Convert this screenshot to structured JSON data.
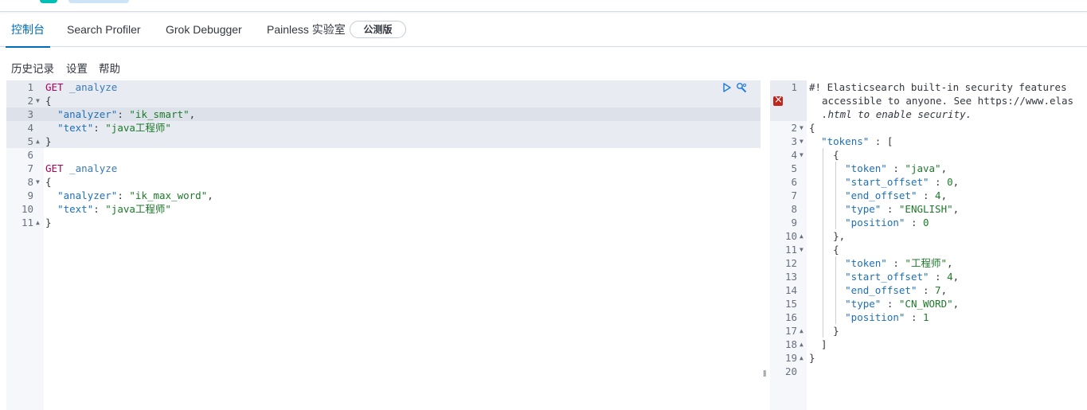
{
  "tabs": [
    {
      "label": "控制台",
      "active": true
    },
    {
      "label": "Search Profiler",
      "active": false
    },
    {
      "label": "Grok Debugger",
      "active": false
    },
    {
      "label": "Painless 实验室",
      "active": false
    }
  ],
  "beta_badge": "公测版",
  "toolbar": {
    "history": "历史记录",
    "settings": "设置",
    "help": "帮助"
  },
  "request": {
    "line_numbers": [
      "1",
      "2",
      "3",
      "4",
      "5",
      "6",
      "7",
      "8",
      "9",
      "10",
      "11"
    ],
    "method_1": "GET",
    "path_1": "_analyze",
    "analyzer_1": "\"ik_smart\"",
    "text_1": "\"java工程师\"",
    "method_2": "GET",
    "path_2": "_analyze",
    "analyzer_2": "\"ik_max_word\"",
    "text_2": "\"java工程师\"",
    "key_analyzer": "\"analyzer\"",
    "key_text": "\"text\""
  },
  "response": {
    "line_numbers": [
      "1",
      "2",
      "3",
      "4",
      "5",
      "6",
      "7",
      "8",
      "9",
      "10",
      "11",
      "12",
      "13",
      "14",
      "15",
      "16",
      "17",
      "18",
      "19",
      "20"
    ],
    "warning_line_1": "#! Elasticsearch built-in security features",
    "warning_line_2": "accessible to anyone. See https://www.elas",
    "warning_line_3": ".html to enable security.",
    "key_tokens": "\"tokens\"",
    "key_token": "\"token\"",
    "key_start_offset": "\"start_offset\"",
    "key_end_offset": "\"end_offset\"",
    "key_type": "\"type\"",
    "key_position": "\"position\"",
    "token_1": {
      "token": "\"java\"",
      "start_offset": "0",
      "end_offset": "4",
      "type": "\"ENGLISH\"",
      "position": "0"
    },
    "token_2": {
      "token": "\"工程师\"",
      "start_offset": "4",
      "end_offset": "7",
      "type": "\"CN_WORD\"",
      "position": "1"
    }
  },
  "icons": {
    "run": "play-icon",
    "options": "wrench-icon",
    "error": "error-icon",
    "resize": "resize-grip-icon"
  },
  "colors": {
    "accent": "#006bb8",
    "method": "#b1005c",
    "string": "#1c7a29",
    "key": "#1e6fba",
    "error": "#bd271e"
  }
}
